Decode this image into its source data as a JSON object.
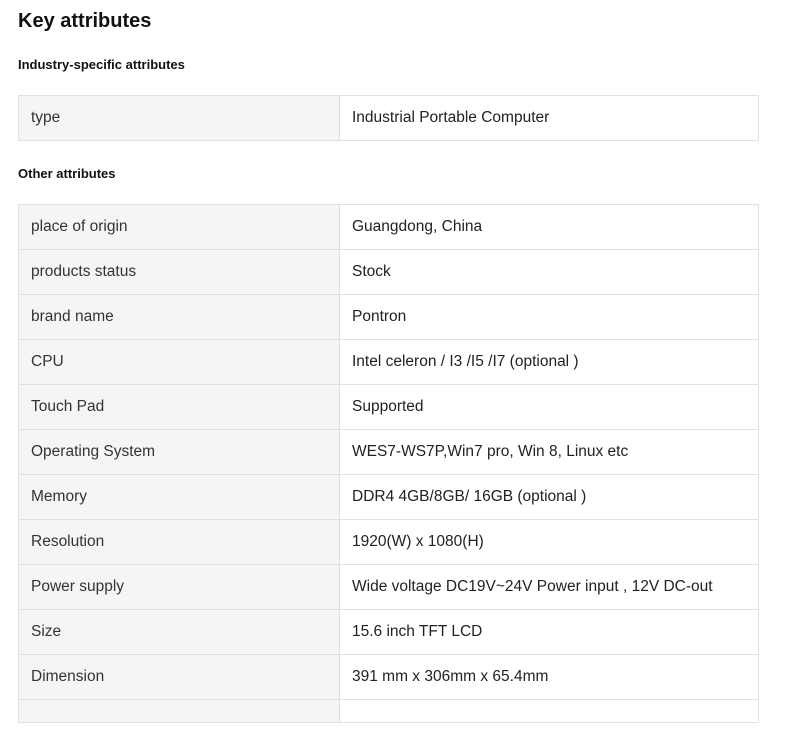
{
  "page": {
    "title": "Key attributes"
  },
  "industry_section": {
    "title": "Industry-specific attributes",
    "rows": [
      {
        "key": "type",
        "value": "Industrial Portable Computer"
      }
    ]
  },
  "other_section": {
    "title": "Other attributes",
    "rows": [
      {
        "key": "place of origin",
        "value": "Guangdong, China"
      },
      {
        "key": "products status",
        "value": "Stock"
      },
      {
        "key": "brand name",
        "value": "Pontron"
      },
      {
        "key": "CPU",
        "value": "Intel celeron / I3 /I5 /I7 (optional )"
      },
      {
        "key": "Touch Pad",
        "value": "Supported"
      },
      {
        "key": "Operating System",
        "value": "WES7-WS7P,Win7 pro, Win 8, Linux etc"
      },
      {
        "key": "Memory",
        "value": "DDR4 4GB/8GB/ 16GB (optional )"
      },
      {
        "key": "Resolution",
        "value": "1920(W) x 1080(H)"
      },
      {
        "key": "Power supply",
        "value": "Wide voltage DC19V~24V Power input , 12V DC-out"
      },
      {
        "key": "Size",
        "value": "15.6 inch TFT LCD"
      },
      {
        "key": "Dimension",
        "value": "391 mm x 306mm x 65.4mm"
      },
      {
        "key": "",
        "value": ""
      }
    ]
  }
}
